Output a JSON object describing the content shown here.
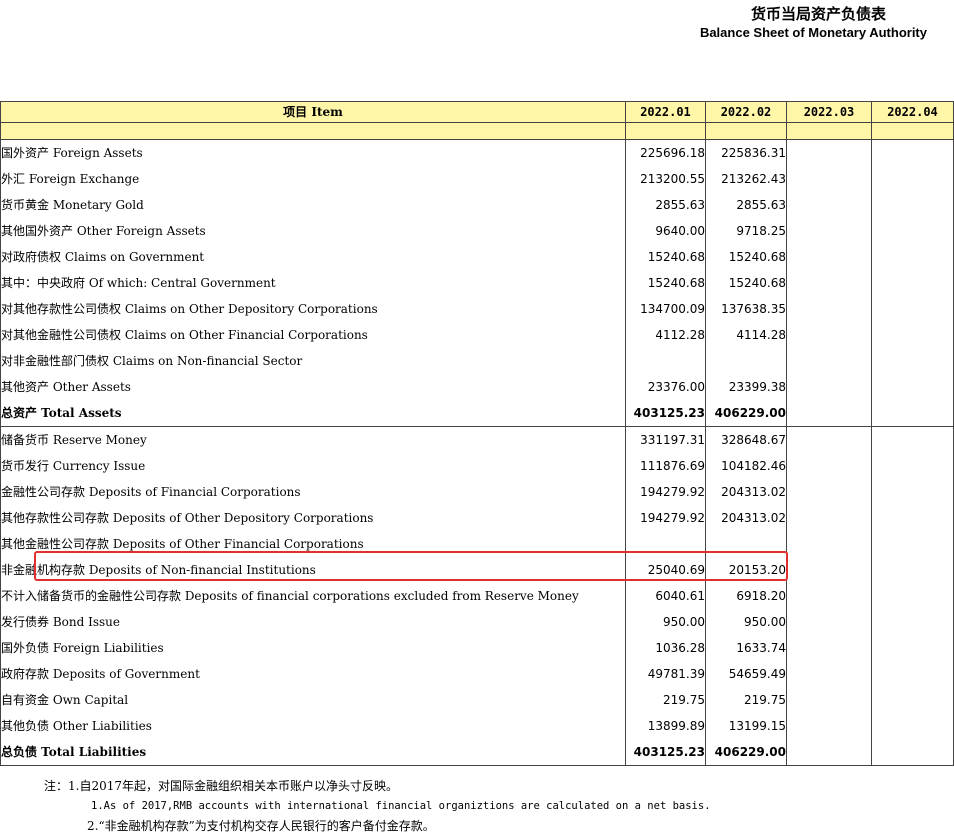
{
  "title_cn": "货币当局资产负债表",
  "title_en": "Balance Sheet of  Monetary Authority",
  "header": {
    "item": "项目 Item",
    "periods": [
      "2022.01",
      "2022.02",
      "2022.03",
      "2022.04"
    ]
  },
  "rows": [
    {
      "label": "国外资产   Foreign Assets",
      "v1": "225696.18",
      "v2": "225836.31"
    },
    {
      "label": "外汇  Foreign Exchange",
      "v1": "213200.55",
      "v2": "213262.43"
    },
    {
      "label": "货币黄金   Monetary Gold",
      "v1": "2855.63",
      "v2": "2855.63"
    },
    {
      "label": "其他国外资产   Other Foreign Assets",
      "v1": "9640.00",
      "v2": "9718.25"
    },
    {
      "label": "对政府债权   Claims on Government",
      "v1": "15240.68",
      "v2": "15240.68"
    },
    {
      "label": "其中：中央政府  Of which: Central Government",
      "v1": "15240.68",
      "v2": "15240.68"
    },
    {
      "label": "对其他存款性公司债权   Claims on Other Depository Corporations",
      "v1": "134700.09",
      "v2": "137638.35"
    },
    {
      "label": "对其他金融性公司债权   Claims on Other Financial Corporations",
      "v1": "4112.28",
      "v2": "4114.28"
    },
    {
      "label": "对非金融性部门债权   Claims on Non-financial Sector",
      "v1": "",
      "v2": ""
    },
    {
      "label": "其他资产   Other Assets",
      "v1": "23376.00",
      "v2": "23399.38"
    },
    {
      "label": "总资产   Total Assets",
      "v1": "403125.23",
      "v2": "406229.00"
    },
    {
      "label": "储备货币   Reserve Money",
      "v1": "331197.31",
      "v2": "328648.67"
    },
    {
      "label": "货币发行   Currency Issue",
      "v1": "111876.69",
      "v2": "104182.46"
    },
    {
      "label": "金融性公司存款   Deposits of  Financial Corporations",
      "v1": "194279.92",
      "v2": "204313.02"
    },
    {
      "label": "其他存款性公司存款   Deposits of  Other Depository Corporations",
      "v1": "194279.92",
      "v2": "204313.02"
    },
    {
      "label": "其他金融性公司存款   Deposits of  Other Financial Corporations",
      "v1": "",
      "v2": ""
    },
    {
      "label": "非金融机构存款 Deposits of  Non-financial Institutions",
      "v1": "25040.69",
      "v2": "20153.20"
    },
    {
      "label": "不计入储备货币的金融性公司存款   Deposits of financial corporations excluded from Reserve Money",
      "v1": "6040.61",
      "v2": "6918.20"
    },
    {
      "label": "发行债券   Bond Issue",
      "v1": "950.00",
      "v2": "950.00"
    },
    {
      "label": "国外负债   Foreign Liabilities",
      "v1": "1036.28",
      "v2": "1633.74"
    },
    {
      "label": "政府存款   Deposits of Government",
      "v1": "49781.39",
      "v2": "54659.49"
    },
    {
      "label": "自有资金   Own Capital",
      "v1": "219.75",
      "v2": "219.75"
    },
    {
      "label": "其他负债   Other Liabilities",
      "v1": "13899.89",
      "v2": "13199.15"
    },
    {
      "label": "总负债   Total  Liabilities",
      "v1": "403125.23",
      "v2": "406229.00"
    }
  ],
  "notes": {
    "n1_cn": "注：1.自2017年起，对国际金融组织相关本币账户以净头寸反映。",
    "n1_en": "1.As of 2017,RMB accounts with international financial organiztions are calculated on a net basis.",
    "n2_cn": "2.“非金融机构存款”为支付机构交存人民银行的客户备付金存款。"
  }
}
